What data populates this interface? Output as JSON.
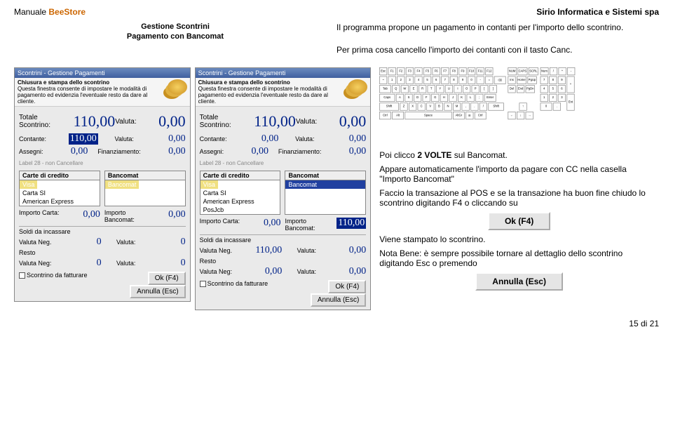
{
  "header": {
    "manual": "Manuale",
    "brand": "BeeStore",
    "company": "Sirio Informatica e Sistemi spa"
  },
  "titles": {
    "section": "Gestione Scontrini",
    "subsection": "Pagamento con Bancomat"
  },
  "intro_p1": "Il programma propone un pagamento in contanti per l'importo dello scontrino.",
  "intro_p2": "Per prima cosa cancello l'importo dei contanti con il tasto Canc.",
  "ss": {
    "titlebar": "Scontrini - Gestione Pagamenti",
    "desc_title": "Chiusura e stampa dello scontrino",
    "desc_text": "Questa finestra consente di impostare le modalità di pagamento ed evidenzia l'eventuale resto da dare al cliente.",
    "lbl_totale": "Totale Scontrino:",
    "lbl_valuta": "Valuta:",
    "lbl_contante": "Contante:",
    "lbl_assegni": "Assegni:",
    "lbl_finanz": "Finanziamento:",
    "greylabel": "Label 28 - non Cancellare",
    "lh_carte": "Carte di credito",
    "lh_banc": "Bancomat",
    "cards": [
      "Visa",
      "Carta SI",
      "American Express"
    ],
    "cards2": [
      "Visa",
      "Carta SI",
      "American Express",
      "PosJcb"
    ],
    "banc": [
      "Bancomat"
    ],
    "lbl_imp_carta": "Importo Carta:",
    "lbl_imp_banc": "Importo Bancomat:",
    "box2_head": "Soldi da incassare",
    "lbl_valneg": "Valuta Neg.",
    "lbl_resto": "Resto",
    "lbl_valneg2": "Valuta Neg:",
    "lbl_fatt": "Scontrino da fatturare",
    "btn_ok": "Ok (F4)",
    "btn_annulla": "Annulla (Esc)"
  },
  "panelA": {
    "totale": "110,00",
    "valuta": "0,00",
    "contante": "110,00",
    "contante_val": "0,00",
    "assegni": "0,00",
    "finanz": "0,00",
    "imp_carta": "0,00",
    "imp_banc": "0,00",
    "soldi_valneg": "0",
    "soldi_valuta": "0",
    "resto_valneg": "0",
    "resto_valuta": "0"
  },
  "panelB": {
    "totale": "110,00",
    "valuta": "0,00",
    "contante": "0,00",
    "contante_val": "0,00",
    "assegni": "0,00",
    "finanz": "0,00",
    "imp_carta": "0,00",
    "imp_banc": "110,00",
    "soldi_valneg": "110,00",
    "soldi_valuta": "0,00",
    "resto_valneg": "0,00",
    "resto_valuta": "0,00"
  },
  "text": {
    "p_click": "Poi clicco ",
    "p_click_bold": "2 VOLTE",
    "p_click_after": " sul Bancomat.",
    "p_appare": "Appare automaticamente l'importo da pagare con CC nella casella \"Importo Bancomat\"",
    "p_trans": "Faccio la transazione al POS e se la transazione ha buon fine chiudo lo scontrino digitando F4 o cliccando su",
    "p_stampa": "Viene stampato lo scontrino.",
    "p_nota": "Nota Bene: è sempre possibile tornare al dettaglio dello scontrino digitando Esc o premendo"
  },
  "buttons": {
    "ok": "Ok (F4)",
    "annulla": "Annulla (Esc)"
  },
  "footer": {
    "page": "15 di 21"
  }
}
